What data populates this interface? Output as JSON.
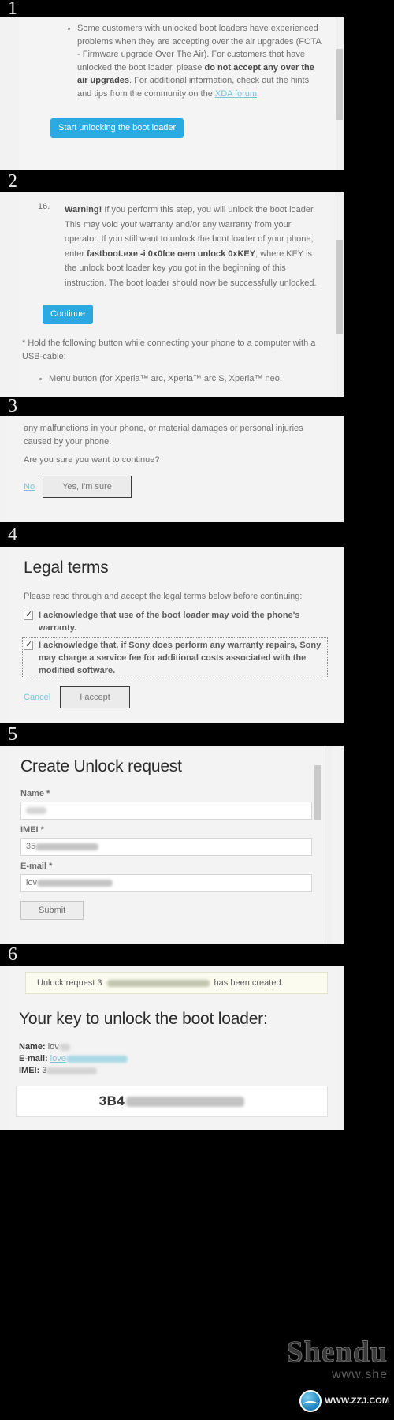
{
  "steps": [
    {
      "number": "1"
    },
    {
      "number": "2"
    },
    {
      "number": "3"
    },
    {
      "number": "4"
    },
    {
      "number": "5"
    },
    {
      "number": "6"
    }
  ],
  "panel1": {
    "bullet_part1": "Some customers with unlocked boot loaders have experienced problems when they are accepting over the air upgrades (FOTA - Firmware upgrade Over The Air). For customers that have unlocked the boot loader, please ",
    "bullet_bold": "do not accept any over the air upgrades",
    "bullet_part2": ". For additional information, check out the hints and tips from the community on the ",
    "bullet_link": "XDA forum",
    "bullet_part3": ".",
    "start_button": "Start unlocking the boot loader"
  },
  "panel2": {
    "step_number": "16.",
    "warning_label": "Warning!",
    "warn_part1": " If you perform this step, you will unlock the boot loader. This may void your warranty and/or any warranty from your operator. If you still want to unlock the boot loader of your phone, enter ",
    "command": "fastboot.exe -i 0x0fce oem unlock 0xKEY",
    "warn_part2": ", where KEY is the unlock boot loader key you got in the beginning of this instruction. The boot loader should now be successfully unlocked.",
    "continue_button": "Continue",
    "footnote": "* Hold the following button while connecting your phone to a computer with a USB-cable:",
    "device_bullet": "Menu button (for Xperia™ arc, Xperia™ arc S, Xperia™ neo,"
  },
  "panel3": {
    "text": "any malfunctions in your phone, or material damages or personal injuries caused by your phone.",
    "question": "Are you sure you want to continue?",
    "no_link": "No",
    "yes_button": "Yes, I'm sure"
  },
  "panel4": {
    "title": "Legal terms",
    "intro": "Please read through and accept the legal terms below before continuing:",
    "checkbox1": "I acknowledge that use of the boot loader may void the phone's warranty.",
    "checkbox2": "I acknowledge that, if Sony does perform any warranty repairs, Sony may charge a service fee for additional costs associated with the modified software.",
    "cancel_link": "Cancel",
    "accept_button": "I accept"
  },
  "panel5": {
    "title": "Create Unlock request",
    "fields": [
      {
        "label": "Name *",
        "value": ""
      },
      {
        "label": "IMEI *",
        "value": "35"
      },
      {
        "label": "E-mail *",
        "value": "lov"
      }
    ],
    "submit_button": "Submit"
  },
  "panel6": {
    "notice_prefix": "Unlock request 3",
    "notice_suffix": "has been created.",
    "title": "Your key to unlock the boot loader:",
    "kv": [
      {
        "label": "Name:",
        "value": "lov"
      },
      {
        "label": "E-mail:",
        "value": "love"
      },
      {
        "label": "IMEI:",
        "value": "3"
      }
    ],
    "key_value": "3B4"
  },
  "watermark": {
    "main": "Shendu",
    "sub": "www.she",
    "url": "WWW.ZZJ.COM"
  },
  "colors": {
    "accent_blue": "#2aaae1",
    "link": "#7cc4d6",
    "band": "#000000",
    "panel_bg": "#f3f3f3"
  }
}
